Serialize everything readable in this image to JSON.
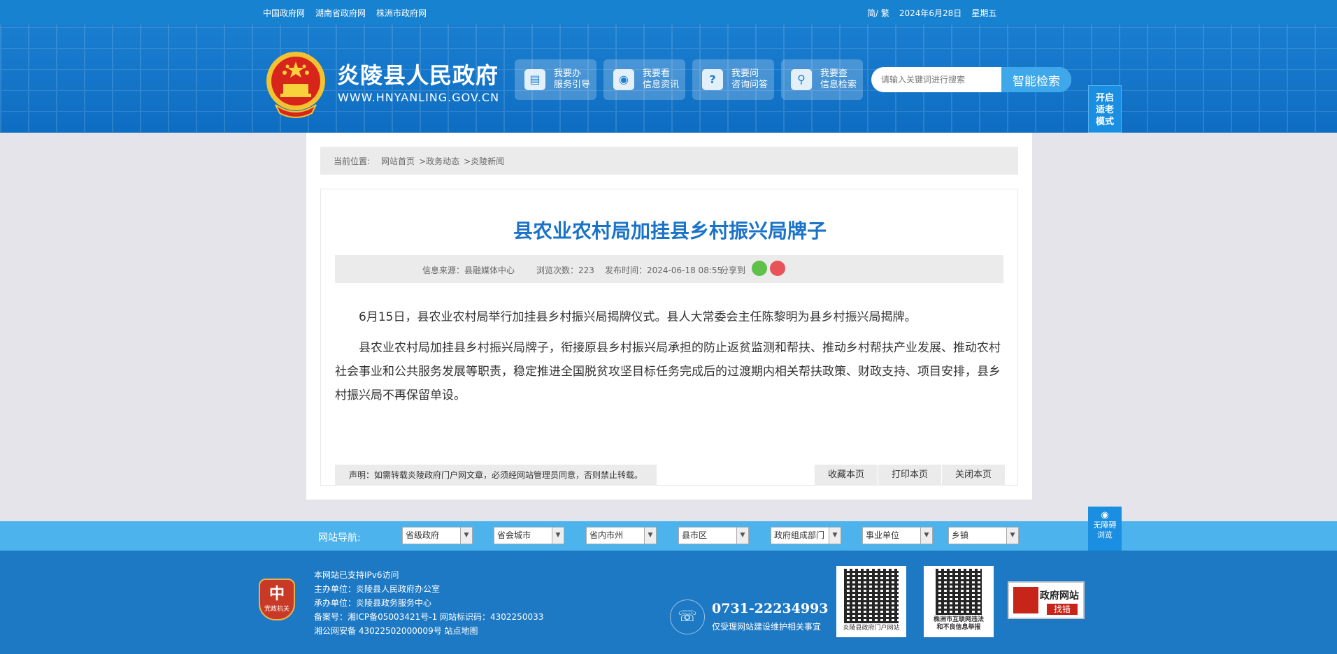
{
  "topbar": {
    "links": [
      "中国政府网",
      "湖南省政府网",
      "株洲市政府网"
    ],
    "lang": "简/ 繁",
    "date": "2024年6月28日",
    "weekday": "星期五"
  },
  "header": {
    "title": "炎陵县人民政府",
    "url": "WWW.HNYANLING.GOV.CN",
    "services": [
      {
        "l1": "我要办",
        "l2": "服务引导",
        "icon": "document-icon"
      },
      {
        "l1": "我要看",
        "l2": "信息资讯",
        "icon": "eye-icon"
      },
      {
        "l1": "我要问",
        "l2": "咨询问答",
        "icon": "question-icon"
      },
      {
        "l1": "我要查",
        "l2": "信息检索",
        "icon": "search-icon"
      }
    ],
    "search_placeholder": "请输入关键词进行搜索",
    "search_button": "智能检索",
    "elder_mode": [
      "开启",
      "适老",
      "模式"
    ]
  },
  "breadcrumb": {
    "label": "当前位置:",
    "items": [
      "网站首页",
      ">政务动态",
      ">炎陵新闻"
    ]
  },
  "article": {
    "title": "县农业农村局加挂县乡村振兴局牌子",
    "source": "信息来源：县融媒体中心",
    "views": "浏览次数：223",
    "published": "发布时间：2024-06-18 08:55",
    "share_label": "分享到",
    "paragraphs": [
      "6月15日，县农业农村局举行加挂县乡村振兴局揭牌仪式。县人大常委会主任陈黎明为县乡村振兴局揭牌。",
      "县农业农村局加挂县乡村振兴局牌子，衔接原县乡村振兴局承担的防止返贫监测和帮扶、推动乡村帮扶产业发展、推动农村社会事业和公共服务发展等职责，稳定推进全国脱贫攻坚目标任务完成后的过渡期内相关帮扶政策、财政支持、项目安排，县乡村振兴局不再保留单设。"
    ],
    "notice": "声明：如需转载炎陵政府门户网文章，必须经网站管理员同意，否则禁止转载。",
    "actions": [
      "收藏本页",
      "打印本页",
      "关闭本页"
    ]
  },
  "site_nav": {
    "label": "网站导航:",
    "selects": [
      "省级政府",
      "省会城市",
      "省内市州",
      "县市区",
      "政府组成部门",
      "事业单位",
      "乡镇"
    ]
  },
  "accessibility": [
    "无障碍",
    "浏览"
  ],
  "footer": {
    "badge": "党政机关",
    "lines": [
      "本网站已支持IPv6访问",
      "主办单位：炎陵县人民政府办公室",
      "承办单位：炎陵县政务服务中心",
      "备案号：湘ICP备05003421号-1 网站标识码：4302250033",
      "湘公网安备 43022502000009号 站点地图"
    ],
    "phone": "0731-22234993",
    "phone_note": "仅受理网站建设维护相关事宜",
    "qr1": "炎陵县政府门户网站",
    "qr2": [
      "株洲市互联网违法",
      "和不良信息举报"
    ],
    "jiucuo_a": "政府网站",
    "jiucuo_b": "找错"
  }
}
